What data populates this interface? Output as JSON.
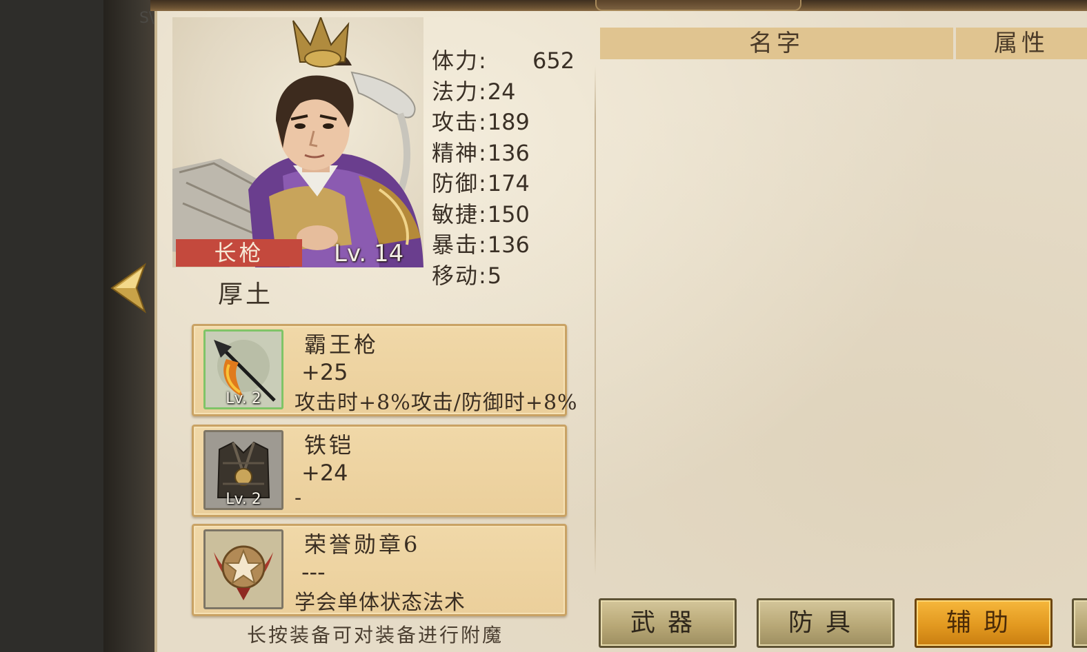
{
  "hero": {
    "weapon_type": "长枪",
    "level": "Lv. 14",
    "name": "厚土"
  },
  "stats": [
    {
      "label": "体力:",
      "value": "652"
    },
    {
      "label": "法力:",
      "value": "24"
    },
    {
      "label": "攻击:",
      "value": "189"
    },
    {
      "label": "精神:",
      "value": "136"
    },
    {
      "label": "防御:",
      "value": "174"
    },
    {
      "label": "敏捷:",
      "value": "150"
    },
    {
      "label": "暴击:",
      "value": "136"
    },
    {
      "label": "移动:",
      "value": "5"
    }
  ],
  "table": {
    "col_name": "名字",
    "col_attr": "属性"
  },
  "equipment": [
    {
      "name": "霸王枪",
      "bonus": "+25",
      "effect": "攻击时+8%攻击/防御时+8%",
      "level": "Lv. 2",
      "icon": "spear-icon"
    },
    {
      "name": "铁铠",
      "bonus": "+24",
      "effect": "-",
      "level": "Lv. 2",
      "icon": "armor-icon"
    },
    {
      "name": "荣誉勋章6",
      "bonus": "---",
      "effect": "学会单体状态法术",
      "level": "",
      "icon": "medal-icon"
    }
  ],
  "hint": "长按装备可对装备进行附魔",
  "tabs": {
    "weapon": "武器",
    "armor": "防具",
    "auxiliary": "辅助"
  },
  "colors": {
    "parchment": "#e6dcc8",
    "card": "#ebcf9b",
    "weapon_tag": "#c4493d",
    "tab_active": "#e29920",
    "tab_inactive": "#b8a877"
  }
}
